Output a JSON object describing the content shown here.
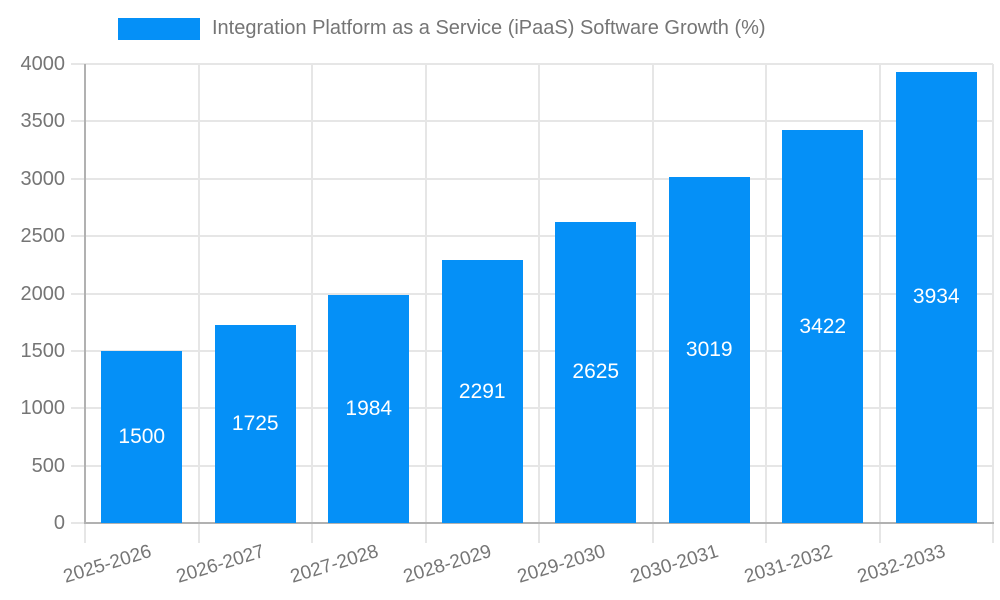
{
  "chart_data": {
    "type": "bar",
    "title": "Integration Platform as a Service (iPaaS) Software Growth (%)",
    "categories": [
      "2025-2026",
      "2026-2027",
      "2027-2028",
      "2028-2029",
      "2029-2030",
      "2030-2031",
      "2031-2032",
      "2032-2033"
    ],
    "values": [
      1500,
      1725,
      1984,
      2291,
      2625,
      3019,
      3422,
      3934
    ],
    "series": [
      {
        "name": "Integration Platform as a Service (iPaaS) Software Growth (%)",
        "values": [
          1500,
          1725,
          1984,
          2291,
          2625,
          3019,
          3422,
          3934
        ]
      }
    ],
    "xlabel": "",
    "ylabel": "",
    "ylim": [
      0,
      4000
    ],
    "yticks": [
      0,
      500,
      1000,
      1500,
      2000,
      2500,
      3000,
      3500,
      4000
    ],
    "grid": true,
    "legend_position": "top",
    "value_labels": "inside-center",
    "colors": {
      "bar": "#0590f7",
      "axis_text": "#757575",
      "grid": "#e6e6e6",
      "axis_line": "#b1b1b1",
      "value_label": "#ffffff"
    }
  }
}
